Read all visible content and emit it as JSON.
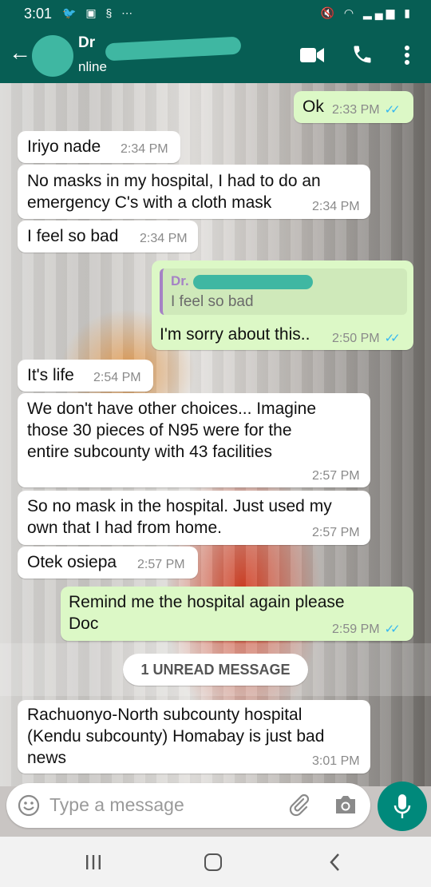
{
  "status_bar": {
    "time": "3:01",
    "left_icons": [
      "twitter-icon",
      "gallery-icon",
      "data-saver-icon",
      "more-dots-icon"
    ],
    "right_icons": [
      "mute-icon",
      "wifi-icon",
      "signal-icon",
      "battery-icon"
    ]
  },
  "header": {
    "contact_name": "Dr",
    "contact_status": "nline",
    "back_icon": "arrow-left-icon",
    "actions": [
      "video-call-icon",
      "voice-call-icon",
      "more-vert-icon"
    ]
  },
  "messages": [
    {
      "dir": "out",
      "text": "Ok",
      "time": "2:33 PM",
      "ticks": "✓✓"
    },
    {
      "dir": "in",
      "text": "Iriyo nade",
      "time": "2:34 PM"
    },
    {
      "dir": "in",
      "text": "No masks in my hospital, I had to do an\nemergency C's with a cloth mask",
      "time": "2:34 PM"
    },
    {
      "dir": "in",
      "text": "I feel so bad",
      "time": "2:34 PM"
    },
    {
      "dir": "out",
      "quote_author": "Dr.",
      "quote_text": "I feel so bad",
      "text": "I'm sorry about this..",
      "time": "2:50 PM",
      "ticks": "✓✓"
    },
    {
      "dir": "in",
      "text": "It's life",
      "time": "2:54 PM"
    },
    {
      "dir": "in",
      "text": "We don't have other choices... Imagine\nthose 30 pieces of N95 were for the\nentire subcounty with 43 facilities",
      "time": "2:57 PM"
    },
    {
      "dir": "in",
      "text": "So no mask in the hospital. Just used my\nown that I had from home.",
      "time": "2:57 PM"
    },
    {
      "dir": "in",
      "text": "Otek osiepa",
      "time": "2:57 PM"
    },
    {
      "dir": "out",
      "text": "Remind me the hospital again please\nDoc",
      "time": "2:59 PM",
      "ticks": "✓✓"
    },
    {
      "dir": "in",
      "text": "Rachuonyo-North subcounty hospital\n(Kendu subcounty) Homabay is just bad\nnews",
      "time": "3:01 PM"
    }
  ],
  "unread_label": "1 UNREAD MESSAGE",
  "composer": {
    "placeholder": "Type a message",
    "icons": [
      "emoji-icon",
      "attach-icon",
      "camera-icon",
      "mic-icon"
    ]
  },
  "colors": {
    "header": "#075e54",
    "outgoing_bubble": "#dcf8c6",
    "incoming_bubble": "#ffffff",
    "read_ticks": "#34b7f1",
    "mic_button": "#00897b"
  }
}
